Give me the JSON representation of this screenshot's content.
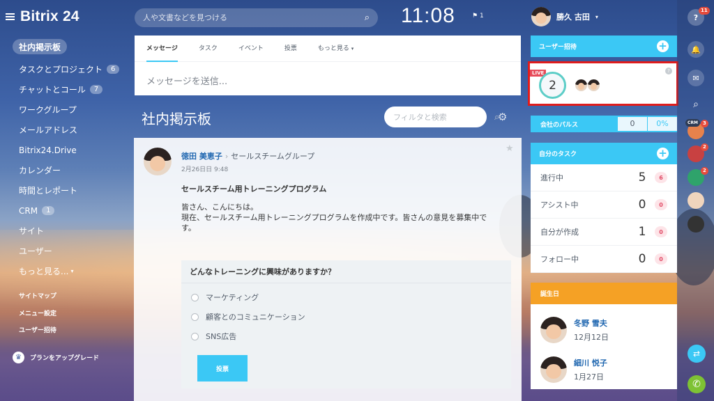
{
  "app": {
    "logo": "Bitrix",
    "logo_num": "24"
  },
  "sidebar": {
    "active": "社内掲示板",
    "items": [
      {
        "label": "タスクとプロジェクト",
        "badge": "6"
      },
      {
        "label": "チャットとコール",
        "badge": "7"
      },
      {
        "label": "ワークグループ",
        "badge": ""
      },
      {
        "label": "メールアドレス",
        "badge": ""
      },
      {
        "label": "Bitrix24.Drive",
        "badge": ""
      },
      {
        "label": "カレンダー",
        "badge": ""
      },
      {
        "label": "時間とレポート",
        "badge": ""
      },
      {
        "label": "CRM",
        "badge": "1"
      },
      {
        "label": "サイト",
        "badge": ""
      },
      {
        "label": "ユーザー",
        "badge": ""
      },
      {
        "label": "もっと見る...",
        "badge": ""
      }
    ],
    "sitemap": "サイトマップ",
    "menu_settings": "メニュー設定",
    "invite": "ユーザー招待",
    "upgrade": "プランをアップグレード"
  },
  "topbar": {
    "search_placeholder": "人や文書などを見つける",
    "clock": "11:08",
    "flag_count": "1",
    "user_name": "勝久 古田"
  },
  "composer": {
    "tabs": [
      "メッセージ",
      "タスク",
      "イベント",
      "投票",
      "もっと見る"
    ],
    "placeholder": "メッセージを送信..."
  },
  "feed": {
    "title": "社内掲示板",
    "filter_placeholder": "フィルタと検索"
  },
  "post": {
    "author": "徳田 美恵子",
    "group": "セールスチームグループ",
    "date": "2月26日日 9:48",
    "title": "セールスチーム用トレーニングプログラム",
    "body_line1": "皆さん、こんにちは。",
    "body_line2": "現在、セールスチーム用トレーニングプログラムを作成中です。皆さんの意見を募集中です。",
    "poll_question": "どんなトレーニングに興味がありますか？",
    "poll_options": [
      "マーケティング",
      "顧客とのコミュニケーション",
      "SNS広告"
    ],
    "vote_label": "投票"
  },
  "right": {
    "invite": "ユーザー招待",
    "live": "LIVE",
    "live_count": "2",
    "pulse_label": "会社のパルス",
    "pulse_value": "0",
    "pulse_percent": "0%",
    "tasks_title": "自分のタスク",
    "tasks": [
      {
        "label": "進行中",
        "count": "5",
        "badge": "6"
      },
      {
        "label": "アシスト中",
        "count": "0",
        "badge": "0"
      },
      {
        "label": "自分が作成",
        "count": "1",
        "badge": "0"
      },
      {
        "label": "フォロー中",
        "count": "0",
        "badge": "0"
      }
    ],
    "birthdays_title": "誕生日",
    "birthdays": [
      {
        "name": "冬野 雪夫",
        "date": "12月12日"
      },
      {
        "name": "細川 悦子",
        "date": "1月27日"
      }
    ]
  },
  "strip": {
    "help_badge": "11",
    "crm_label": "CRM",
    "av_badges": [
      "3",
      "2",
      "2"
    ]
  },
  "colors": {
    "accent": "#3bc8f5",
    "orange": "#f5a125",
    "highlight": "#e01c1c"
  }
}
